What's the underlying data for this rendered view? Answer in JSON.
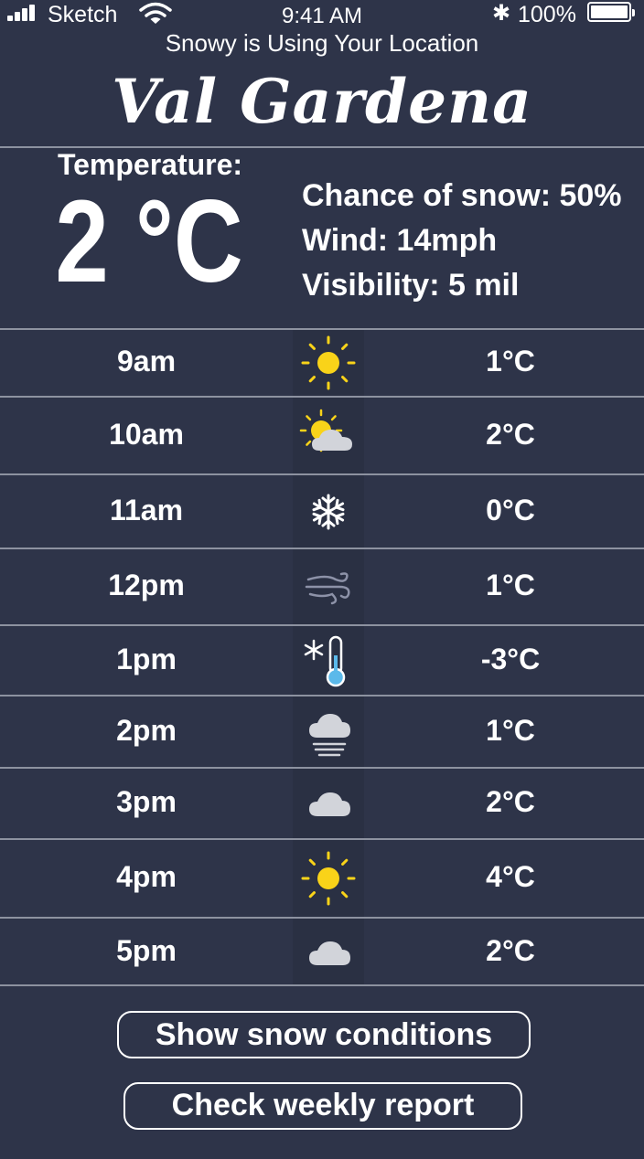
{
  "status_bar": {
    "carrier": "Sketch",
    "time": "9:41 AM",
    "battery": "100%"
  },
  "location_note": "Snowy is Using Your Location",
  "city": "Val Gardena",
  "current": {
    "label": "Temperature:",
    "temperature": "2 °C",
    "snow_chance": "Chance of snow: 50%",
    "wind": "Wind: 14mph",
    "visibility": "Visibility: 5 mil"
  },
  "hourly": [
    {
      "time": "9am",
      "icon": "sun-icon",
      "temp": "1°C"
    },
    {
      "time": "10am",
      "icon": "partly-cloudy-icon",
      "temp": "2°C"
    },
    {
      "time": "11am",
      "icon": "snowflake-icon",
      "temp": "0°C"
    },
    {
      "time": "12pm",
      "icon": "wind-icon",
      "temp": "1°C"
    },
    {
      "time": "1pm",
      "icon": "cold-thermometer-icon",
      "temp": "-3°C"
    },
    {
      "time": "2pm",
      "icon": "fog-icon",
      "temp": "1°C"
    },
    {
      "time": "3pm",
      "icon": "cloud-icon",
      "temp": "2°C"
    },
    {
      "time": "4pm",
      "icon": "sun-icon",
      "temp": "4°C"
    },
    {
      "time": "5pm",
      "icon": "cloud-icon",
      "temp": "2°C"
    }
  ],
  "buttons": {
    "snow_conditions": "Show snow conditions",
    "weekly_report": "Check weekly report"
  },
  "colors": {
    "background": "#2e3449",
    "sun": "#f9d319",
    "cloud": "#d2d4da",
    "divider": "#8d92a0"
  }
}
